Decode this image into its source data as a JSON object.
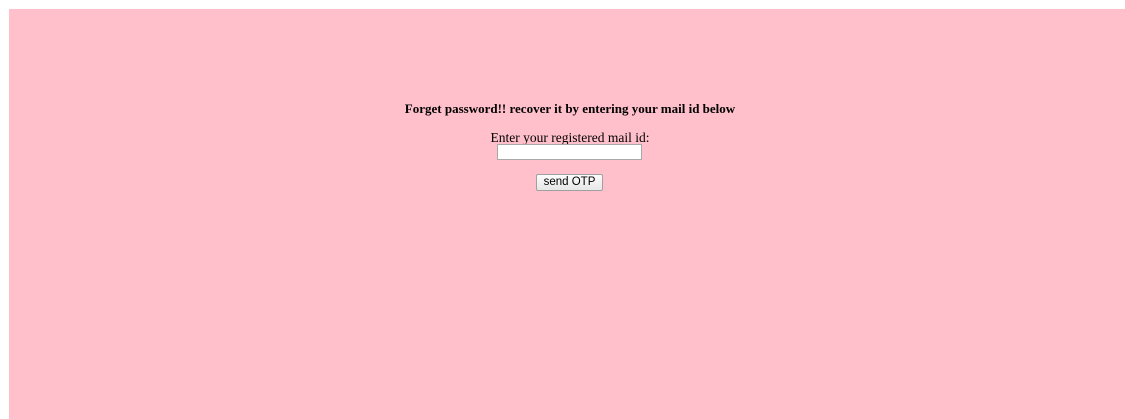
{
  "page": {
    "background_color": "#ffc0cb"
  },
  "heading": "Forget password!! recover it by entering your mail id below",
  "form": {
    "email_label": "Enter your registered mail id:",
    "email_value": "",
    "send_button_label": "send OTP"
  }
}
